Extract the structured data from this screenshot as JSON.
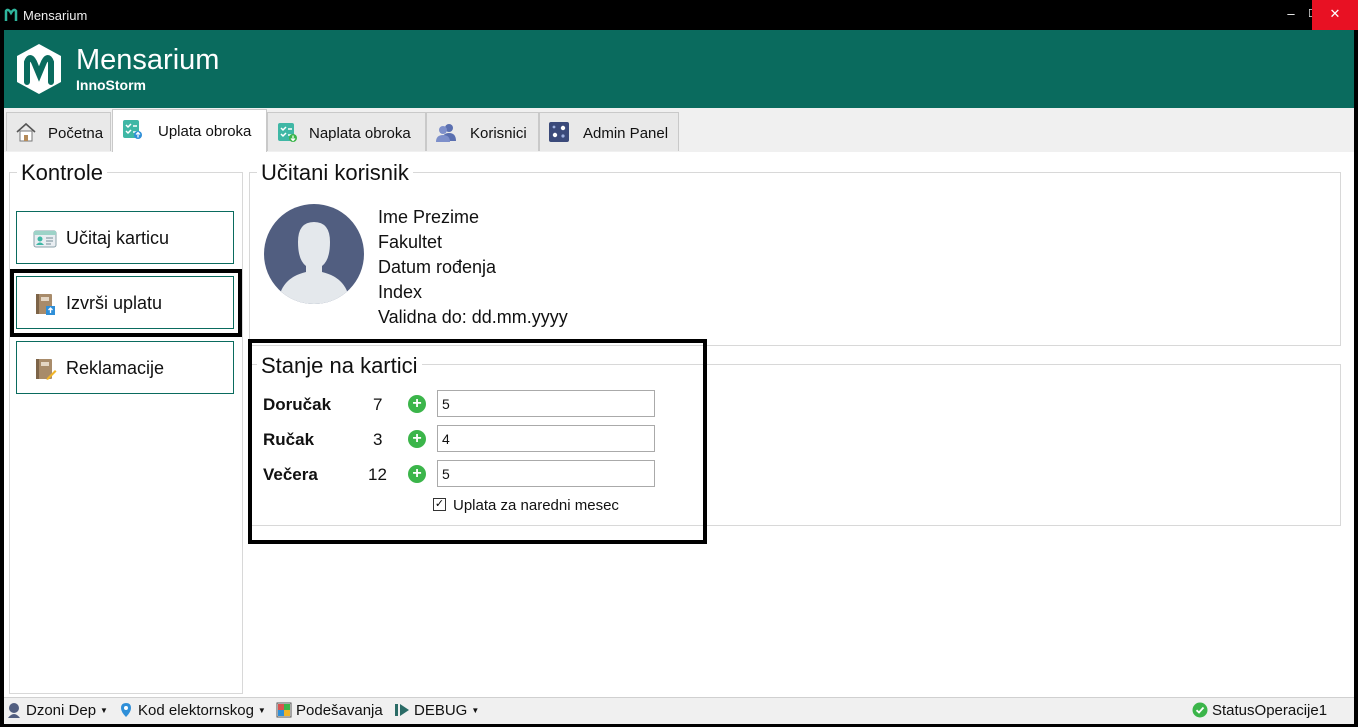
{
  "window": {
    "title": "Mensarium",
    "controls": {
      "minimize": "–",
      "maximize": "☐",
      "close": "✕"
    }
  },
  "header": {
    "brand": "Mensarium",
    "subtitle": "InnoStorm",
    "color": "#0a6b5e"
  },
  "tabs": [
    {
      "label": "Početna",
      "icon": "home-icon"
    },
    {
      "label": "Uplata obroka",
      "icon": "checklist-upload-icon",
      "active": true
    },
    {
      "label": "Naplata obroka",
      "icon": "checklist-download-icon"
    },
    {
      "label": "Korisnici",
      "icon": "users-icon"
    },
    {
      "label": "Admin Panel",
      "icon": "admin-panel-icon"
    }
  ],
  "controls": {
    "title": "Kontrole",
    "buttons": [
      {
        "label": "Učitaj karticu",
        "icon": "id-card-icon"
      },
      {
        "label": "Izvrši uplatu",
        "icon": "book-upload-icon"
      },
      {
        "label": "Reklamacije",
        "icon": "book-edit-icon"
      }
    ]
  },
  "user": {
    "title": "Učitani korisnik",
    "name": "Ime Prezime",
    "faculty": "Fakultet",
    "birth": "Datum rođenja",
    "index": "Index",
    "valid": "Validna do: dd.mm.yyyy"
  },
  "card": {
    "title": "Stanje na kartici",
    "meals": [
      {
        "label": "Doručak",
        "count": "7",
        "input": "5"
      },
      {
        "label": "Ručak",
        "count": "3",
        "input": "4"
      },
      {
        "label": "Večera",
        "count": "12",
        "input": "5"
      }
    ],
    "next_month_label": "Uplata za naredni mesec",
    "next_month_checked": true
  },
  "statusbar": {
    "user": "Dzoni Dep",
    "location": "Kod elektornskog",
    "settings": "Podešavanja",
    "debug": "DEBUG",
    "status": "StatusOperacije1"
  }
}
